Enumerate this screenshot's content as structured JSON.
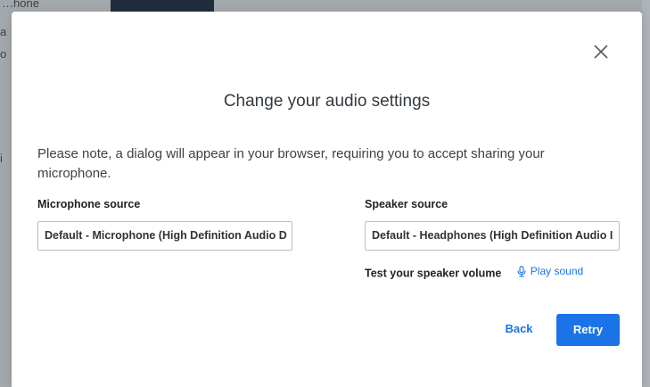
{
  "background": {
    "text": "…hone",
    "fragment_1": "a",
    "fragment_2": "o",
    "fragment_3": "i"
  },
  "dialog": {
    "title": "Change your audio settings",
    "note": "Please note, a dialog will appear in your browser, requiring you to accept sharing your microphone.",
    "close_icon": "close-icon",
    "microphone": {
      "label": "Microphone source",
      "value": "Default - Microphone (High Definition Audio D"
    },
    "speaker": {
      "label": "Speaker source",
      "value": "Default - Headphones (High Definition Audio I"
    },
    "test": {
      "label": "Test your speaker volume",
      "link_label": "Play sound",
      "link_icon": "microphone-icon"
    },
    "buttons": {
      "back": "Back",
      "retry": "Retry"
    }
  },
  "colors": {
    "accent": "#1a73e8",
    "overlay": "#a3a8ad",
    "dialog_bg": "#ffffff"
  }
}
